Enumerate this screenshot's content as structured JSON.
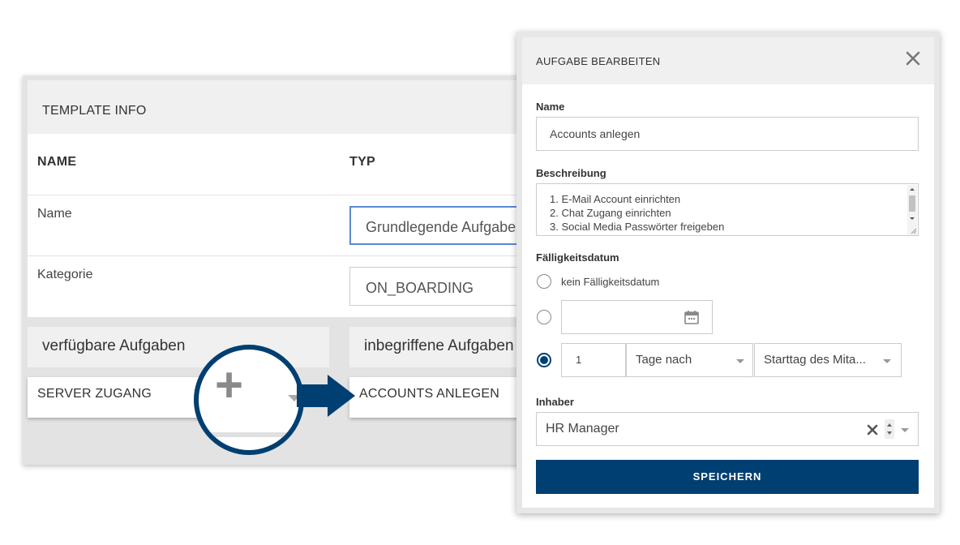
{
  "template": {
    "title": "TEMPLATE INFO",
    "columns": {
      "name": "NAME",
      "type": "TYP"
    },
    "rows": [
      {
        "label": "Name",
        "value": "Grundlegende Aufgaben"
      },
      {
        "label": "Kategorie",
        "value": "ON_BOARDING"
      }
    ],
    "available_tasks_title": "verfügbare Aufgaben",
    "included_tasks_title": "inbegriffene Aufgaben",
    "available_task": "SERVER ZUGANG",
    "included_task": "ACCOUNTS ANLEGEN",
    "add_symbol": "+"
  },
  "dialog": {
    "title": "AUFGABE BEARBEITEN",
    "close_icon": "close-icon",
    "name_label": "Name",
    "name_value": "Accounts anlegen",
    "description_label": "Beschreibung",
    "description_lines": [
      "1. E-Mail Account einrichten",
      "2. Chat Zugang einrichten",
      "3. Social Media Passwörter freigeben"
    ],
    "due_label": "Fälligkeitsdatum",
    "due_options": {
      "none_label": "kein Fälligkeitsdatum",
      "date_value": "",
      "relative_amount": "1",
      "relative_unit": "Tage nach",
      "relative_reference": "Starttag des Mita..."
    },
    "selected_due_option": "relative",
    "owner_label": "Inhaber",
    "owner_value": "HR Manager",
    "save_label": "SPEICHERN"
  },
  "colors": {
    "primary": "#003f71",
    "focus_border": "#5b8ad1",
    "panel_bg": "#f0f0f0"
  }
}
